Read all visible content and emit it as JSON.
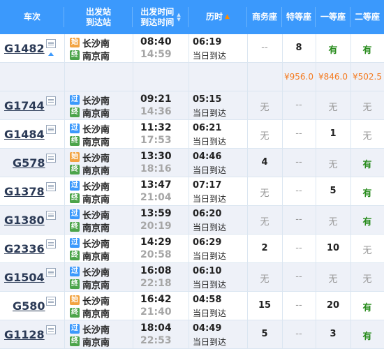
{
  "header": {
    "train": "车次",
    "station_top": "出发站",
    "station_bottom": "到达站",
    "time_top": "出发时间",
    "time_bottom": "到达时间",
    "duration": "历时",
    "business": "商务座",
    "premium": "特等座",
    "first": "一等座",
    "second": "二等座"
  },
  "badges": {
    "start": "始",
    "pass": "过",
    "end": "终"
  },
  "price_row": {
    "premium": "¥956.0",
    "first": "¥846.0",
    "second": "¥502.5"
  },
  "trains": [
    {
      "no": "G1482",
      "dep_station": "长沙南",
      "arr_station": "南京南",
      "dep_type": "start",
      "dep": "08:40",
      "arr": "14:59",
      "dur": "06:19",
      "note": "当日到达",
      "business": "--",
      "premium": "8",
      "first": "有",
      "second": "有"
    },
    {
      "no": "G1744",
      "dep_station": "长沙南",
      "arr_station": "南京南",
      "dep_type": "pass",
      "dep": "09:21",
      "arr": "14:36",
      "dur": "05:15",
      "note": "当日到达",
      "business": "无",
      "premium": "--",
      "first": "无",
      "second": "无"
    },
    {
      "no": "G1484",
      "dep_station": "长沙南",
      "arr_station": "南京南",
      "dep_type": "pass",
      "dep": "11:32",
      "arr": "17:53",
      "dur": "06:21",
      "note": "当日到达",
      "business": "无",
      "premium": "--",
      "first": "1",
      "second": "无"
    },
    {
      "no": "G578",
      "dep_station": "长沙南",
      "arr_station": "南京南",
      "dep_type": "start",
      "dep": "13:30",
      "arr": "18:16",
      "dur": "04:46",
      "note": "当日到达",
      "business": "4",
      "premium": "--",
      "first": "无",
      "second": "有"
    },
    {
      "no": "G1378",
      "dep_station": "长沙南",
      "arr_station": "南京南",
      "dep_type": "pass",
      "dep": "13:47",
      "arr": "21:04",
      "dur": "07:17",
      "note": "当日到达",
      "business": "无",
      "premium": "--",
      "first": "5",
      "second": "有"
    },
    {
      "no": "G1380",
      "dep_station": "长沙南",
      "arr_station": "南京南",
      "dep_type": "pass",
      "dep": "13:59",
      "arr": "20:19",
      "dur": "06:20",
      "note": "当日到达",
      "business": "无",
      "premium": "--",
      "first": "无",
      "second": "有"
    },
    {
      "no": "G2336",
      "dep_station": "长沙南",
      "arr_station": "南京南",
      "dep_type": "pass",
      "dep": "14:29",
      "arr": "20:58",
      "dur": "06:29",
      "note": "当日到达",
      "business": "2",
      "premium": "--",
      "first": "10",
      "second": "无"
    },
    {
      "no": "G1504",
      "dep_station": "长沙南",
      "arr_station": "南京南",
      "dep_type": "pass",
      "dep": "16:08",
      "arr": "22:18",
      "dur": "06:10",
      "note": "当日到达",
      "business": "无",
      "premium": "--",
      "first": "无",
      "second": "无"
    },
    {
      "no": "G580",
      "dep_station": "长沙南",
      "arr_station": "南京南",
      "dep_type": "start",
      "dep": "16:42",
      "arr": "21:40",
      "dur": "04:58",
      "note": "当日到达",
      "business": "15",
      "premium": "--",
      "first": "20",
      "second": "有"
    },
    {
      "no": "G1128",
      "dep_station": "长沙南",
      "arr_station": "南京南",
      "dep_type": "pass",
      "dep": "18:04",
      "arr": "22:53",
      "dur": "04:49",
      "note": "当日到达",
      "business": "5",
      "premium": "--",
      "first": "3",
      "second": "有"
    }
  ]
}
